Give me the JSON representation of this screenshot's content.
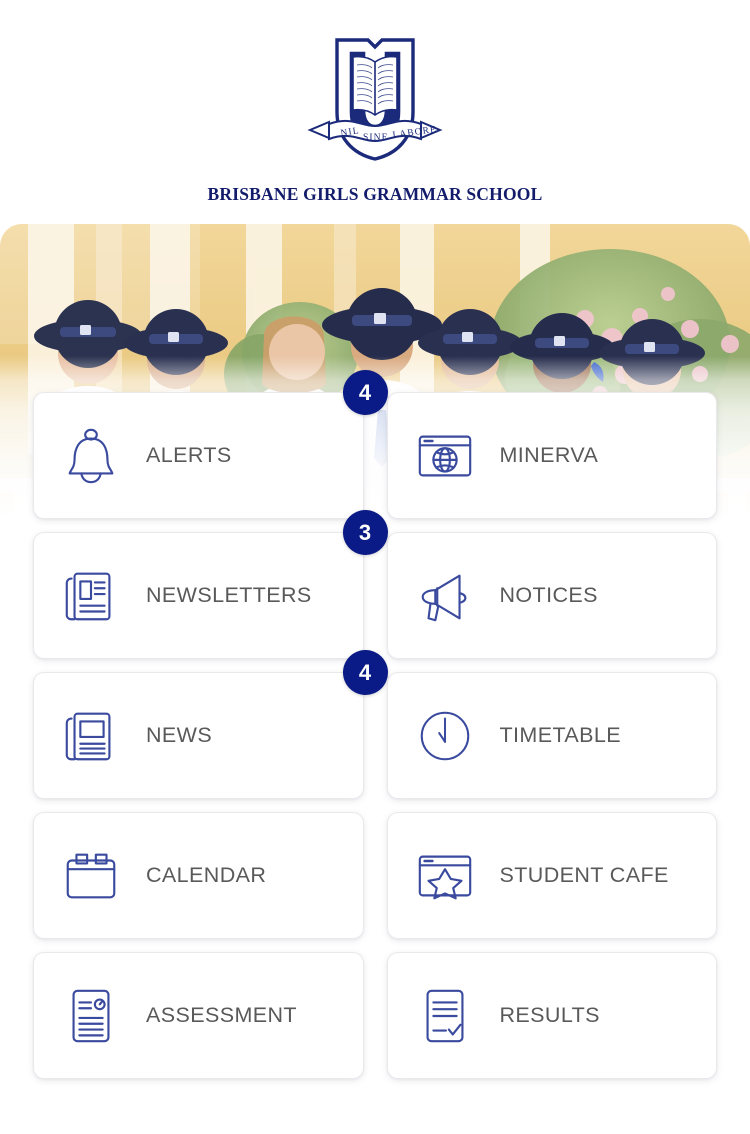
{
  "header": {
    "logo": {
      "icon": "school-crest-icon",
      "motto_words": [
        "NIL",
        "SINE",
        "LABORE"
      ]
    },
    "school_name": "BRISBANE GIRLS GRAMMAR SCHOOL"
  },
  "hero": {
    "icon": "students-photo-banner",
    "description": "Seven schoolgirls in white shirts, blue ties and navy wide-brim hats standing in front of a yellow building with garden foliage"
  },
  "colors": {
    "brand_navy": "#131c6b",
    "badge_navy": "#0a1a86",
    "icon_stroke": "#3a4a9e",
    "label_gray": "#595959",
    "tile_bg": "#ffffff",
    "tile_border": "#e9e9ec",
    "page_bg": "#ffffff"
  },
  "tiles": [
    {
      "label": "ALERTS",
      "icon": "bell-icon",
      "badge": "4"
    },
    {
      "label": "MINERVA",
      "icon": "browser-globe-icon",
      "badge": null
    },
    {
      "label": "NEWSLETTERS",
      "icon": "newspaper-stack-icon",
      "badge": "3"
    },
    {
      "label": "NOTICES",
      "icon": "megaphone-icon",
      "badge": null
    },
    {
      "label": "NEWS",
      "icon": "newspaper-icon",
      "badge": "4"
    },
    {
      "label": "TIMETABLE",
      "icon": "clock-icon",
      "badge": null
    },
    {
      "label": "CALENDAR",
      "icon": "calendar-icon",
      "badge": null
    },
    {
      "label": "STUDENT CAFE",
      "icon": "browser-star-icon",
      "badge": null
    },
    {
      "label": "ASSESSMENT",
      "icon": "document-clock-icon",
      "badge": null
    },
    {
      "label": "RESULTS",
      "icon": "document-check-icon",
      "badge": null
    }
  ]
}
